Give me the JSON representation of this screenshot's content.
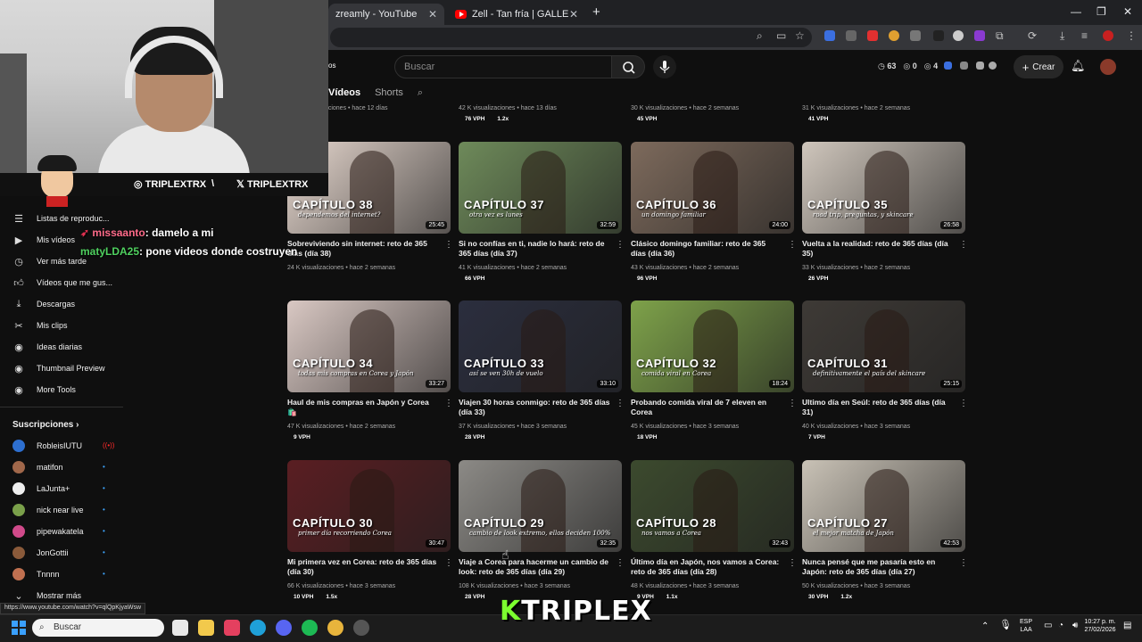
{
  "browser": {
    "tabs": [
      {
        "label": "zreamly - YouTube",
        "active": true
      },
      {
        "label": "Zell - Tan fría | GALLERY SESSIO",
        "active": false
      }
    ],
    "close_glyph": "✕",
    "new_tab": "+",
    "window_controls": [
      "—",
      "❐",
      "✕"
    ]
  },
  "header": {
    "search_placeholder": "Buscar",
    "stats": [
      "63",
      "0",
      "4"
    ],
    "create_label": "Crear",
    "create_plus": "+"
  },
  "channel_tabs": [
    {
      "label": "Vídeos",
      "active": true
    },
    {
      "label": "Shorts",
      "active": false
    }
  ],
  "channel_tab_partial": "os",
  "sidebar": {
    "items": [
      {
        "label": "Listas de reproduc...",
        "icon": "playlist-icon"
      },
      {
        "label": "Mis vídeos",
        "icon": "video-icon"
      },
      {
        "label": "Ver más tarde",
        "icon": "clock-icon"
      },
      {
        "label": "Vídeos que me gus...",
        "icon": "thumb-up-icon"
      },
      {
        "label": "Descargas",
        "icon": "download-icon"
      },
      {
        "label": "Mis clips",
        "icon": "scissors-icon"
      },
      {
        "label": "Ideas diarias",
        "icon": "ideas-icon"
      },
      {
        "label": "Thumbnail Preview",
        "icon": "preview-icon"
      },
      {
        "label": "More Tools",
        "icon": "tools-icon"
      }
    ],
    "subscriptions_title": "Suscripciones",
    "subscriptions": [
      {
        "label": "RobleisIUTU",
        "color": "#2d6fd0",
        "live": true
      },
      {
        "label": "matifon",
        "color": "#a0674a",
        "live": false
      },
      {
        "label": "LaJunta+",
        "color": "#eeeeee",
        "live": false
      },
      {
        "label": "nick near live",
        "color": "#7aa04a",
        "live": false
      },
      {
        "label": "pipewakatela",
        "color": "#d04a8a",
        "live": false
      },
      {
        "label": "JonGottii",
        "color": "#8a5a3a",
        "live": false
      },
      {
        "label": "Tnnnn",
        "color": "#c07050",
        "live": false
      }
    ],
    "show_more": "Mostrar más"
  },
  "top_row": [
    {
      "meta": "...ciones • hace 12 días",
      "vph": []
    },
    {
      "meta": "42 K visualizaciones • hace 13 días",
      "vph": [
        "76 VPH",
        "1.2x"
      ]
    },
    {
      "meta": "30 K visualizaciones • hace 2 semanas",
      "vph": [
        "45 VPH"
      ]
    },
    {
      "meta": "31 K visualizaciones • hace 2 semanas",
      "vph": [
        "41 VPH"
      ]
    }
  ],
  "videos": [
    {
      "chapter": "CAPÍTULO 38",
      "sub": "dependemos del internet?",
      "duration": "25:45",
      "title": "Sobreviviendo sin internet: reto de 365 días (día 38)",
      "meta": "24 K visualizaciones • hace 2 semanas",
      "vph": [],
      "bg": "#e7d8cf"
    },
    {
      "chapter": "CAPÍTULO 37",
      "sub": "otra vez es lunes",
      "duration": "32:59",
      "title": "Si no confías en ti, nadie lo hará: reto de 365 días (día 37)",
      "meta": "41 K visualizaciones • hace 2 semanas",
      "vph": [
        "66 VPH"
      ],
      "bg": "#6e8a5a"
    },
    {
      "chapter": "CAPÍTULO 36",
      "sub": "un domingo familiar",
      "duration": "24:00",
      "title": "Clásico domingo familiar: reto de 365 días (día 36)",
      "meta": "43 K visualizaciones • hace 2 semanas",
      "vph": [
        "96 VPH"
      ],
      "bg": "#7d6a5c"
    },
    {
      "chapter": "CAPÍTULO 35",
      "sub": "road trip, preguntas, y skincare",
      "duration": "26:58",
      "title": "Vuelta a la realidad: reto de 365 días (día 35)",
      "meta": "33 K visualizaciones • hace 2 semanas",
      "vph": [
        "26 VPH"
      ],
      "bg": "#cfc6bc"
    },
    {
      "chapter": "CAPÍTULO 34",
      "sub": "todas mis compras en Corea y Japón",
      "duration": "33:27",
      "title": "Haul de mis compras en Japón y Corea 🛍️",
      "meta": "47 K visualizaciones • hace 2 semanas",
      "vph": [
        "9 VPH"
      ],
      "bg": "#d9c8c3"
    },
    {
      "chapter": "CAPÍTULO 33",
      "sub": "así se ven 30h de vuelo",
      "duration": "33:10",
      "title": "Viajen 30 horas conmigo: reto de 365 días (día 33)",
      "meta": "37 K visualizaciones • hace 3 semanas",
      "vph": [
        "28 VPH"
      ],
      "bg": "#2b2e3e"
    },
    {
      "chapter": "CAPÍTULO 32",
      "sub": "comida viral en Corea",
      "duration": "18:24",
      "title": "Probando comida viral de 7 eleven en Corea",
      "meta": "45 K visualizaciones • hace 3 semanas",
      "vph": [
        "18 VPH"
      ],
      "bg": "#7ea24a"
    },
    {
      "chapter": "CAPÍTULO 31",
      "sub": "definitivamente el país del skincare",
      "duration": "25:15",
      "title": "Ultimo día en Seúl: reto de 365 días (día 31)",
      "meta": "40 K visualizaciones • hace 3 semanas",
      "vph": [
        "7 VPH"
      ],
      "bg": "#3e3a36"
    },
    {
      "chapter": "CAPÍTULO 30",
      "sub": "primer día recorriendo Corea",
      "duration": "30:47",
      "title": "Mi primera vez en Corea: reto de 365 días (día 30)",
      "meta": "66 K visualizaciones • hace 3 semanas",
      "vph": [
        "10 VPH",
        "1.5x"
      ],
      "bg": "#5a1e22"
    },
    {
      "chapter": "CAPÍTULO 29",
      "sub": "cambio de look extremo, ellos deciden 100%",
      "duration": "32:35",
      "title": "Viaje a Corea para hacerme un cambio de look: reto de 365 días (día 29)",
      "meta": "108 K visualizaciones • hace 3 semanas",
      "vph": [
        "28 VPH"
      ],
      "bg": "#8c8a86"
    },
    {
      "chapter": "CAPÍTULO 28",
      "sub": "nos vamos a Corea",
      "duration": "32:43",
      "title": "Último día en Japón, nos vamos a Corea: reto de 365 días (día 28)",
      "meta": "48 K visualizaciones • hace 3 semanas",
      "vph": [
        "9 VPH",
        "1.1x"
      ],
      "bg": "#3c4a2e"
    },
    {
      "chapter": "CAPÍTULO 27",
      "sub": "el mejor matcha de Japón",
      "duration": "42:53",
      "title": "Nunca pensé que me pasaría esto en Japón: reto de 365 días (día 27)",
      "meta": "50 K visualizaciones • hace 3 semanas",
      "vph": [
        "30 VPH",
        "1.2x"
      ],
      "bg": "#c9c2b6"
    }
  ],
  "overlay": {
    "instagram": "TRIPLEXTRX",
    "x_handle": "TRIPLEXTRX",
    "separator": "\\",
    "chat": [
      {
        "user": "missaanto",
        "msg": ": damelo a mi"
      },
      {
        "user": "matyLDA25",
        "msg": ": pone videos donde costruyen"
      }
    ],
    "brand_k": "K",
    "brand_rest": "TRIPLEX"
  },
  "status_url": "https://www.youtube.com/watch?v=qlQpKjyaWsw",
  "taskbar": {
    "search": "Buscar",
    "lang": "ESP",
    "lang2": "LAA",
    "time": "10:27 p. m.",
    "date": "27/02/2026"
  }
}
